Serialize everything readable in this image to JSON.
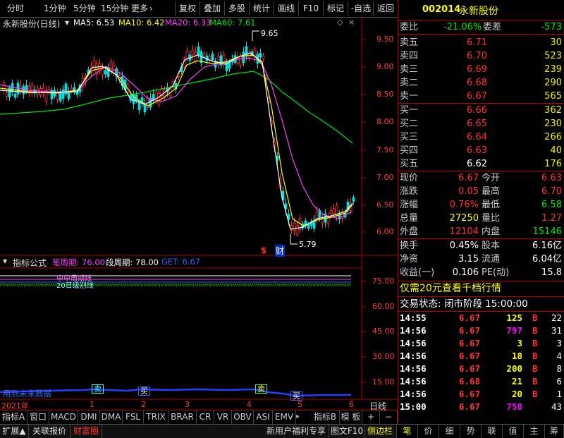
{
  "toolbar": {
    "left": [
      "分时",
      "1分钟",
      "5分钟",
      "15分钟",
      "更多"
    ],
    "more_arrow": "›",
    "buttons": [
      "复权",
      "叠加",
      "多股",
      "统计",
      "画线",
      "F10",
      "标记",
      "-自选",
      "返回"
    ]
  },
  "chart": {
    "title": "永新股份(日线)",
    "ma": [
      {
        "label": "MA5: 6.53",
        "color": "#ffffff"
      },
      {
        "label": "MA10: 6.42",
        "color": "#ffff00"
      },
      {
        "label": "MA20: 6.33",
        "color": "#ff40ff"
      },
      {
        "label": "MA60: 7.61",
        "color": "#00e600"
      }
    ],
    "ticks": [
      "9.50",
      "9.00",
      "8.50",
      "8.00",
      "7.50",
      "7.00",
      "6.50",
      "6.00"
    ],
    "high_label": "9.65",
    "low_label": "5.79",
    "event_s": "$",
    "event_cai": "财"
  },
  "indicator": {
    "title": "指标公式",
    "params": [
      {
        "label": "笔周期: 76.00",
        "color": "#ff40ff"
      },
      {
        "label": "段周期: 78.00",
        "color": "#ffffff"
      },
      {
        "label": "GET: 6.67",
        "color": "#3060ff"
      }
    ],
    "ticks": [
      "75.00",
      "60.00",
      "45.00",
      "30.00",
      "15.00"
    ],
    "overlay_text": "中中周期线",
    "overlay_sub": "20日级别线",
    "future_text": "用到未来数据",
    "signals": [
      "卖",
      "买",
      "卖",
      "买"
    ]
  },
  "xaxis": {
    "year": "2021年",
    "months": [
      "1",
      "2",
      "3",
      "4",
      "5",
      "6"
    ],
    "period": "日线"
  },
  "tabs": {
    "left": [
      "指标A",
      "窗口",
      "MACD",
      "DMI",
      "DMA",
      "FSL",
      "TRIX",
      "BRAR",
      "CR",
      "VR",
      "OBV",
      "ASI",
      "EMV"
    ],
    "right": [
      "指标B",
      "模 板",
      "+",
      "−"
    ]
  },
  "bottom": {
    "left": [
      "扩展▲",
      "关联报价",
      "财富圈"
    ],
    "promo": "新用户福利专享",
    "right": [
      "图文F10",
      "侧边栏"
    ]
  },
  "quote": {
    "code": "002014",
    "name": "永新股份",
    "weibi_label": "委比",
    "weibi": "-21.06%",
    "weicha_label": "委差",
    "weicha": "-573",
    "asks": [
      {
        "label": "卖五",
        "price": "6.71",
        "vol": "30"
      },
      {
        "label": "卖四",
        "price": "6.70",
        "vol": "523"
      },
      {
        "label": "卖三",
        "price": "6.69",
        "vol": "239"
      },
      {
        "label": "卖二",
        "price": "6.68",
        "vol": "290"
      },
      {
        "label": "卖一",
        "price": "6.67",
        "vol": "565"
      }
    ],
    "bids": [
      {
        "label": "买一",
        "price": "6.66",
        "vol": "362"
      },
      {
        "label": "买二",
        "price": "6.65",
        "vol": "230"
      },
      {
        "label": "买三",
        "price": "6.64",
        "vol": "266"
      },
      {
        "label": "买四",
        "price": "6.63",
        "vol": "40"
      },
      {
        "label": "买五",
        "price": "6.62",
        "vol": "176"
      }
    ],
    "stats": [
      {
        "l1": "现价",
        "v1": "6.67",
        "c1": "#ff3232",
        "l2": "今开",
        "v2": "6.63",
        "c2": "#ff3232"
      },
      {
        "l1": "涨跌",
        "v1": "0.05",
        "c1": "#ff3232",
        "l2": "最高",
        "v2": "6.70",
        "c2": "#ff3232"
      },
      {
        "l1": "涨幅",
        "v1": "0.76%",
        "c1": "#ff3232",
        "l2": "最低",
        "v2": "6.58",
        "c2": "#00e600"
      },
      {
        "l1": "总量",
        "v1": "27250",
        "c1": "#ffff00",
        "l2": "量比",
        "v2": "1.27",
        "c2": "#ff3232"
      },
      {
        "l1": "外盘",
        "v1": "12104",
        "c1": "#ff3232",
        "l2": "内盘",
        "v2": "15146",
        "c2": "#00e600"
      }
    ],
    "stats2": [
      {
        "l1": "换手",
        "v1": "0.45%",
        "l2": "股本",
        "v2": "6.16亿"
      },
      {
        "l1": "净资",
        "v1": "3.15",
        "l2": "流通",
        "v2": "6.04亿"
      },
      {
        "l1": "收益(一)",
        "v1": "0.106",
        "l2": "PE(动)",
        "v2": "15.8"
      }
    ],
    "promo": "仅需20元查看千档行情",
    "status": "交易状态: 闭市阶段 15:00:00",
    "ticks": [
      {
        "t": "14:55",
        "p": "6.67",
        "v": "125",
        "vc": "#ffff00",
        "d": "B",
        "n": "22"
      },
      {
        "t": "14:56",
        "p": "6.67",
        "v": "797",
        "vc": "#ff00ff",
        "d": "B",
        "n": "31"
      },
      {
        "t": "14:56",
        "p": "6.67",
        "v": "3",
        "vc": "#ffff00",
        "d": "B",
        "n": "3"
      },
      {
        "t": "14:56",
        "p": "6.67",
        "v": "18",
        "vc": "#ffff00",
        "d": "B",
        "n": "4"
      },
      {
        "t": "14:56",
        "p": "6.67",
        "v": "200",
        "vc": "#ffff00",
        "d": "B",
        "n": "8"
      },
      {
        "t": "14:56",
        "p": "6.68",
        "v": "21",
        "vc": "#ffff00",
        "d": "B",
        "n": "6"
      },
      {
        "t": "14:56",
        "p": "6.67",
        "v": "20",
        "vc": "#ffff00",
        "d": "B",
        "n": "1"
      },
      {
        "t": "15:00",
        "p": "6.67",
        "v": "758",
        "vc": "#ff00ff",
        "d": "",
        "n": "43"
      }
    ],
    "bottom_tabs": [
      "笔",
      "价",
      "细",
      "势",
      "联",
      "值",
      "主",
      "筹"
    ]
  },
  "colors": {
    "up": "#ff3232",
    "down": "#00e600",
    "bg": "#000000",
    "border": "#b00000"
  }
}
